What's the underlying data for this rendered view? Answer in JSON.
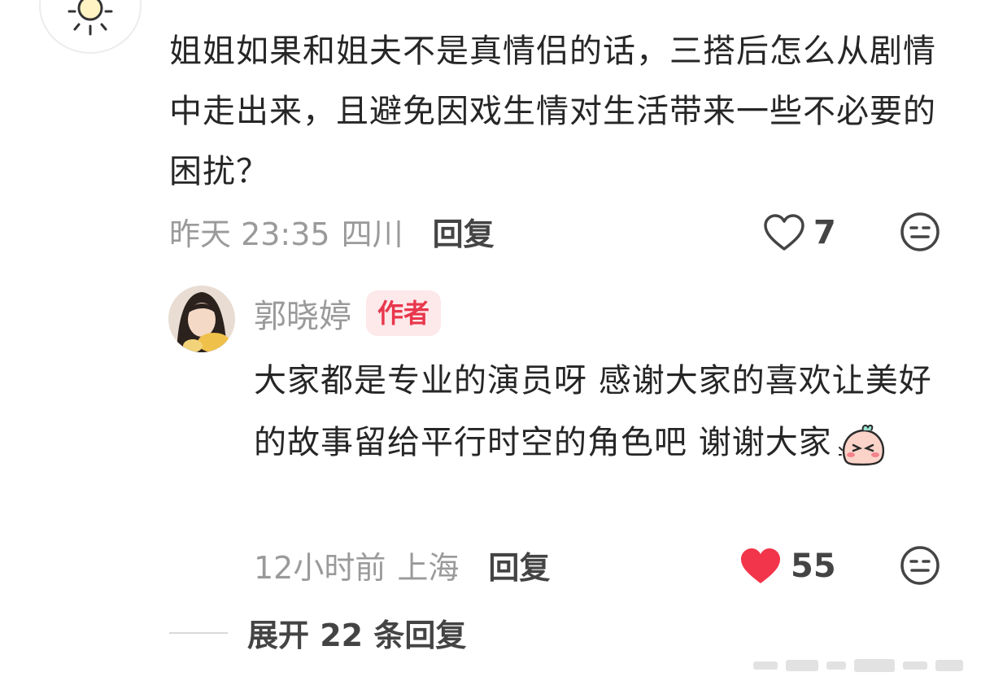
{
  "comment": {
    "text": "姐姐如果和姐夫不是真情侣的话，三搭后怎么从剧情中走出来，且避免因戏生情对生活带来一些不必要的困扰？",
    "time": "昨天 23:35",
    "location": "四川",
    "reply_label": "回复",
    "like_count": "7",
    "avatar_icon": "sun-icon"
  },
  "reply": {
    "author": "郭晓婷",
    "badge": "作者",
    "text": "大家都是专业的演员呀 感谢大家的喜欢让美好的故事留给平行时空的角色吧 谢谢大家",
    "emoji": "shy-sticker-icon",
    "time": "12小时前",
    "location": "上海",
    "reply_label": "回复",
    "like_count": "55",
    "liked": true,
    "like_color": "#f2354a"
  },
  "expand": {
    "label": "展开 22 条回复"
  },
  "colors": {
    "meta": "#9a9a9a",
    "badge_bg": "#fde8ea",
    "badge_text": "#e8374c"
  }
}
